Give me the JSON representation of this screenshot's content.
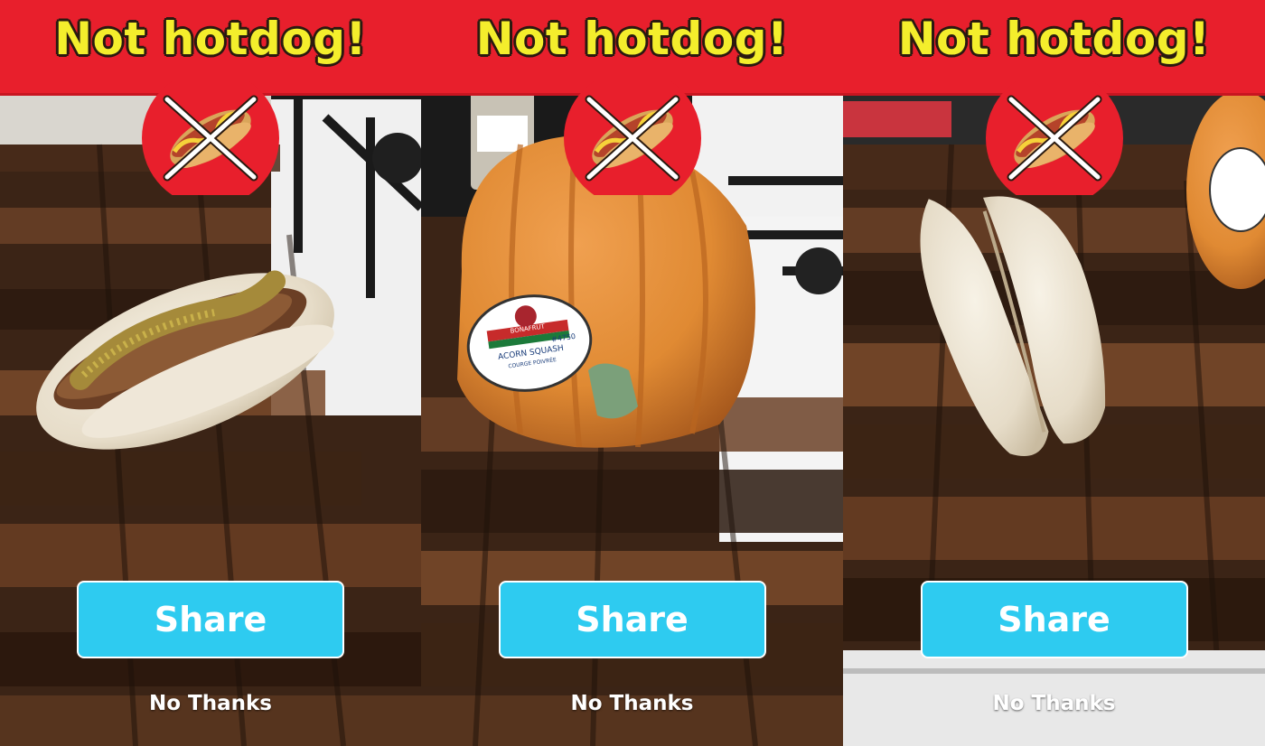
{
  "screens": [
    {
      "banner_title": "Not hotdog!",
      "share_label": "Share",
      "dismiss_label": "No Thanks",
      "photo_subject": "hotdog-with-mustard"
    },
    {
      "banner_title": "Not hotdog!",
      "share_label": "Share",
      "dismiss_label": "No Thanks",
      "photo_subject": "acorn-squash",
      "sticker": {
        "brand": "BONAFRUT",
        "product": "ACORN SQUASH",
        "subtitle": "COURGE POIVRÉE",
        "plu": "#4750"
      }
    },
    {
      "banner_title": "Not hotdog!",
      "share_label": "Share",
      "dismiss_label": "No Thanks",
      "photo_subject": "empty-hotdog-bun"
    }
  ],
  "icons": {
    "badge": "no-hotdog-icon"
  },
  "colors": {
    "banner": "#e81f2c",
    "title_text": "#f4ee2c",
    "share_button": "#2ecbf0",
    "badge_circle": "#e81f2c",
    "text_light": "#ffffff"
  }
}
